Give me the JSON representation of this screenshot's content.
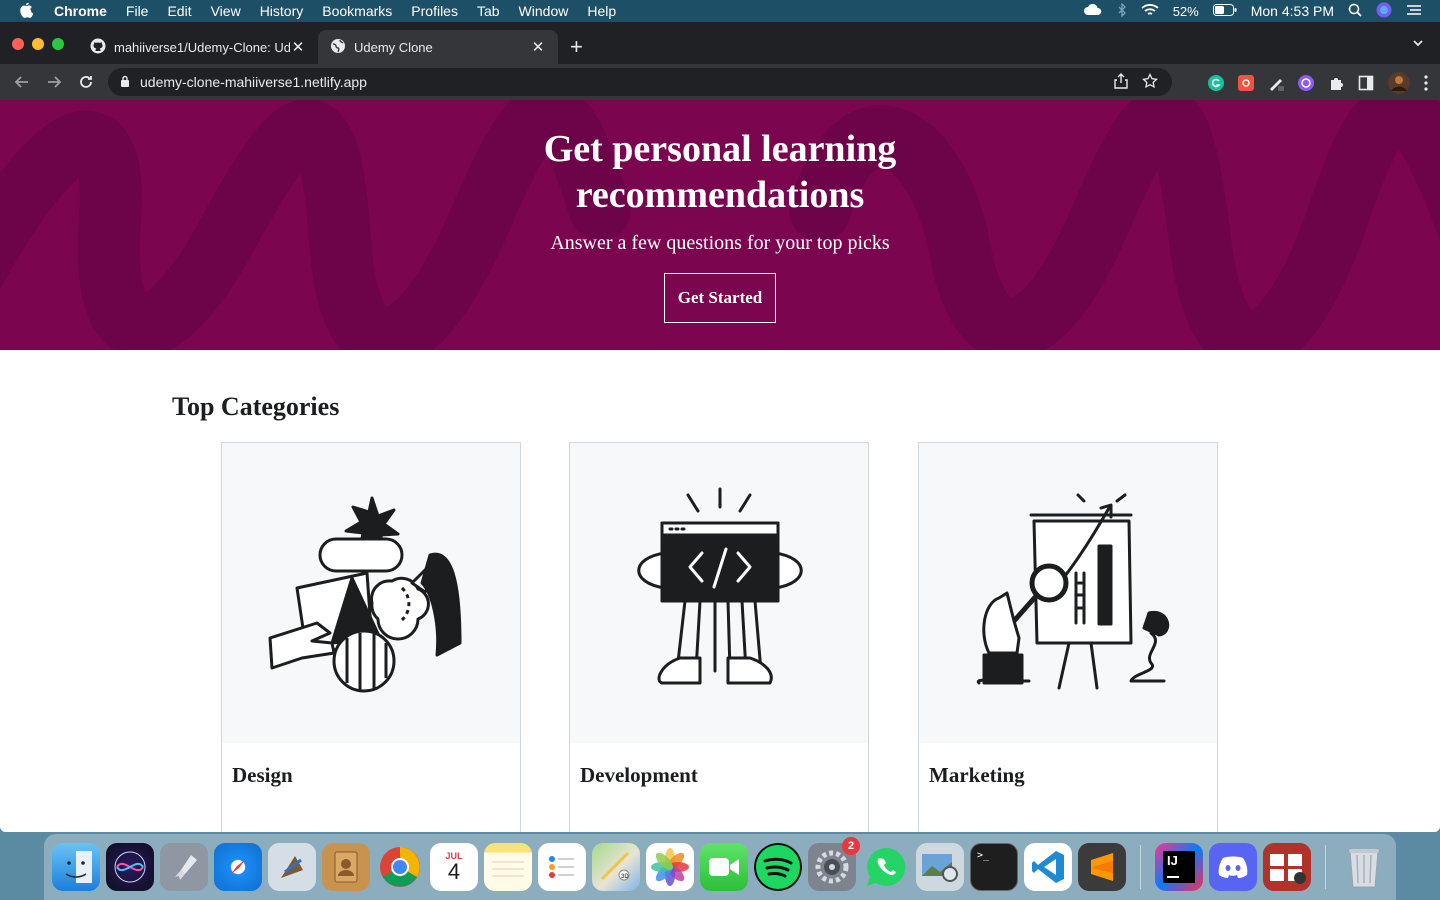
{
  "menubar": {
    "app": "Chrome",
    "items": [
      "File",
      "Edit",
      "View",
      "History",
      "Bookmarks",
      "Profiles",
      "Tab",
      "Window",
      "Help"
    ],
    "battery": "52%",
    "clock": "Mon 4:53 PM"
  },
  "browser": {
    "tabs": [
      {
        "title": "mahiiverse1/Udemy-Clone: Udemy",
        "icon": "github-icon"
      },
      {
        "title": "Udemy Clone",
        "icon": "globe-icon"
      }
    ],
    "url": "udemy-clone-mahiiverse1.netlify.app"
  },
  "hero": {
    "title": "Get personal learning recommendations",
    "subtitle": "Answer a few questions for your top picks",
    "cta": "Get Started",
    "background": "#7c0550"
  },
  "categories": {
    "title": "Top Categories",
    "items": [
      {
        "label": "Design"
      },
      {
        "label": "Development"
      },
      {
        "label": "Marketing"
      }
    ]
  },
  "dock": {
    "apps": [
      "Finder",
      "Siri",
      "Launchpad",
      "Safari",
      "Mail",
      "Contacts",
      "Chrome",
      "Calendar",
      "Notes",
      "Reminders",
      "Maps",
      "Photos",
      "FaceTime",
      "Spotify",
      "System Preferences",
      "WhatsApp",
      "Preview",
      "Terminal",
      "VS Code",
      "Sublime Text",
      "IntelliJ IDEA",
      "Discord",
      "Photo Booth",
      "Trash"
    ],
    "calendar_month": "JUL",
    "calendar_day": "4",
    "settings_badge": "2"
  }
}
